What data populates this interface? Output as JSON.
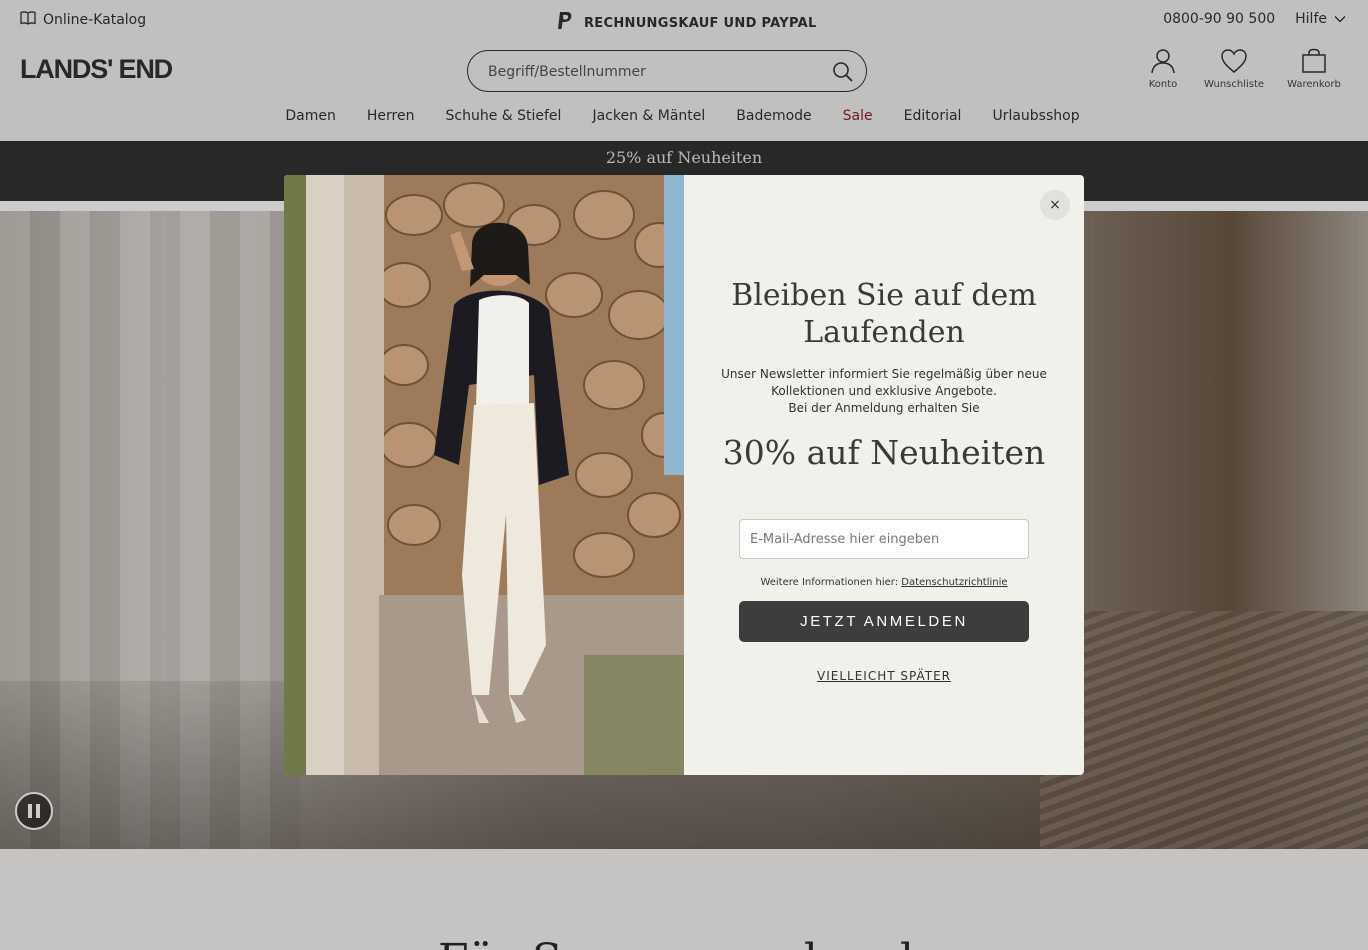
{
  "util_bar": {
    "catalog_label": "Online-Katalog",
    "payment_label": "RECHNUNGSKAUF UND PAYPAL",
    "phone": "0800-90 90 500",
    "help_label": "Hilfe"
  },
  "header": {
    "logo": "LANDS' END",
    "search_placeholder": "Begriff/Bestellnummer",
    "icons": {
      "account": "Konto",
      "wishlist": "Wunschliste",
      "cart": "Warenkorb"
    }
  },
  "nav": {
    "items": [
      "Damen",
      "Herren",
      "Schuhe & Stiefel",
      "Jacken & Mäntel",
      "Bademode",
      "Sale",
      "Editorial",
      "Urlaubsshop"
    ]
  },
  "promo": {
    "text": "25% auf Neuheiten"
  },
  "modal": {
    "close_label": "×",
    "title_line1": "Bleiben Sie auf dem",
    "title_line2": "Laufenden",
    "desc_line1": "Unser Newsletter informiert Sie regelmäßig über neue",
    "desc_line2": "Kollektionen und exklusive Angebote.",
    "desc_line3": "Bei der Anmeldung erhalten Sie",
    "offer": "30% auf Neuheiten",
    "email_placeholder": "E-Mail-Adresse hier eingeben",
    "privacy_prefix": "Weitere Informationen hier:",
    "privacy_link": "Datenschutzrichtlinie",
    "submit_label": "JETZT ANMELDEN",
    "later_label": "VIELLEICHT SPÄTER"
  },
  "lower": {
    "heading": "Für Sommer und mehr"
  },
  "colors": {
    "sale": "#9b1b30",
    "promo_bg": "#333333",
    "header_bg": "#f1f0ee",
    "button_bg": "#3d3d3d"
  }
}
